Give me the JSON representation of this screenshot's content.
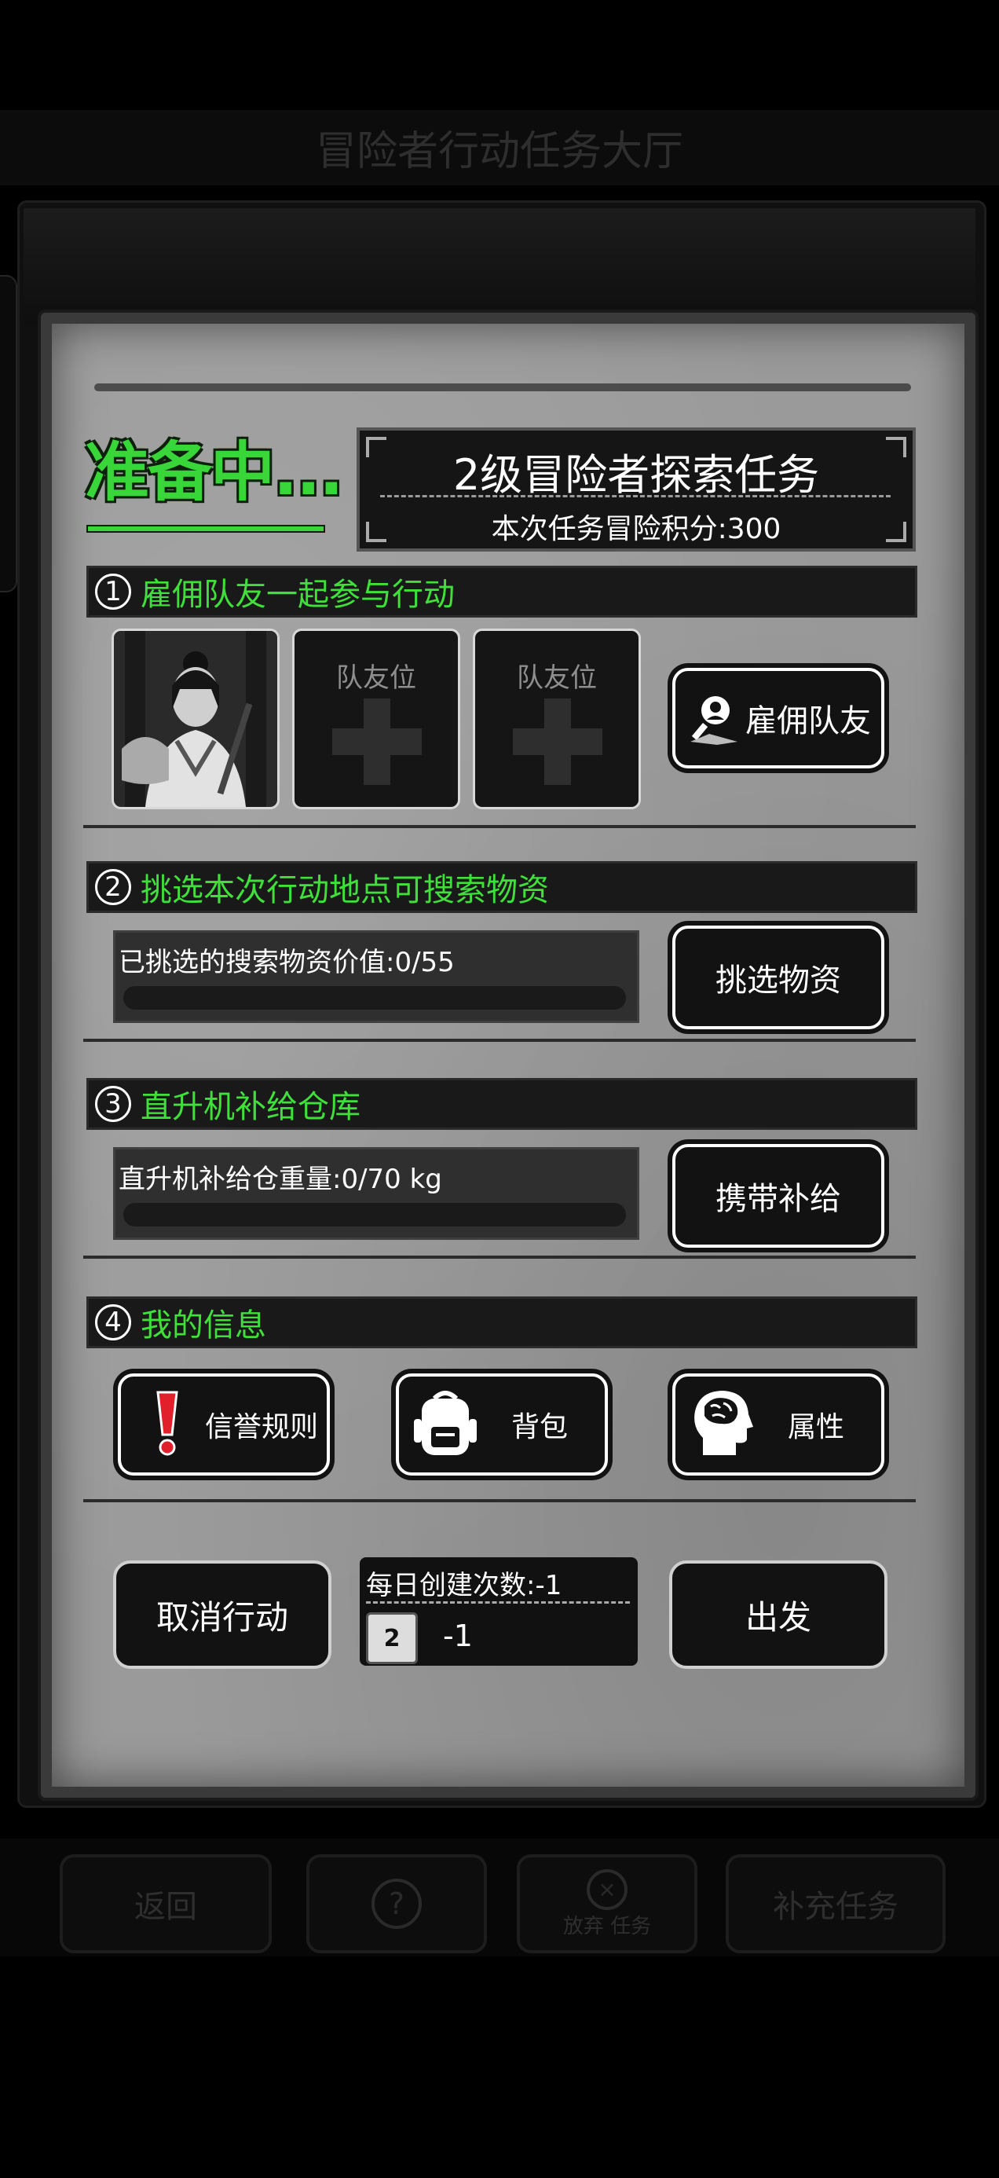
{
  "background": {
    "title": "冒险者行动任务大厅",
    "bottom_buttons": {
      "back": "返回",
      "help_icon": "question-icon",
      "abandon": "放弃 任务",
      "supplement": "补充任务"
    }
  },
  "status": "准备中...",
  "task": {
    "title": "2级冒险者探索任务",
    "score": "本次任务冒险积分:300"
  },
  "sections": [
    {
      "num": "1",
      "title": "雇佣队友一起参与行动"
    },
    {
      "num": "2",
      "title": "挑选本次行动地点可搜索物资"
    },
    {
      "num": "3",
      "title": "直升机补给仓库"
    },
    {
      "num": "4",
      "title": "我的信息"
    }
  ],
  "team": {
    "slot_label": "队友位",
    "hire_button": "雇佣队友"
  },
  "supplies": {
    "progress_text": "已挑选的搜索物资价值:0/55",
    "progress": 0,
    "button": "挑选物资"
  },
  "helicopter": {
    "progress_text": "直升机补给仓重量:0/70 kg",
    "progress": 0,
    "button": "携带补给"
  },
  "info": {
    "reputation": "信誉规则",
    "backpack": "背包",
    "attributes": "属性"
  },
  "actions": {
    "cancel": "取消行动",
    "daily_label": "每日创建次数:-1",
    "level_badge": "2",
    "daily_value": "-1",
    "depart": "出发"
  },
  "colors": {
    "accent_green": "#3fe03a",
    "panel_gray": "#9a9a9a"
  }
}
